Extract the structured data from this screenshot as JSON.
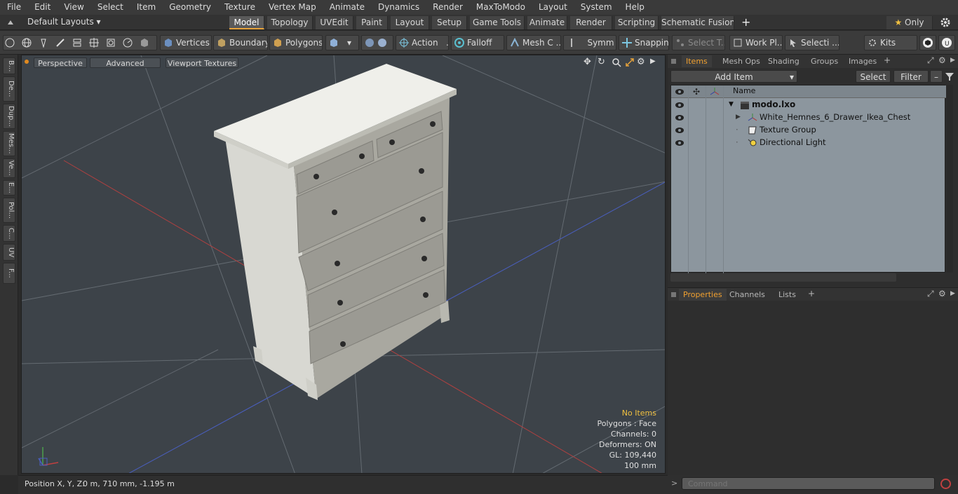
{
  "menu": [
    "File",
    "Edit",
    "View",
    "Select",
    "Item",
    "Geometry",
    "Texture",
    "Vertex Map",
    "Animate",
    "Dynamics",
    "Render",
    "MaxToModo",
    "Layout",
    "System",
    "Help"
  ],
  "layout_selector": "Default Layouts",
  "layout_tabs": [
    "Model",
    "Topology",
    "UVEdit",
    "Paint",
    "Layout",
    "Setup",
    "Game Tools",
    "Animate",
    "Render",
    "Scripting",
    "Schematic Fusion"
  ],
  "active_layout_tab": "Model",
  "only_label": "Only",
  "toolbar": {
    "vertices": "Vertices",
    "boundary": "Boundary",
    "polygons": "Polygons",
    "action": "Action",
    "action_more": "...",
    "falloff": "Falloff",
    "mesh_c": "Mesh C ...",
    "symm": "Symm ...",
    "snapping": "Snapping",
    "select_t": "Select T...",
    "work_pl": "Work Pl...",
    "selecti": "Selecti ...",
    "kits": "Kits"
  },
  "left_tabs": [
    "B...",
    "De...",
    "Dup...",
    "Mes...",
    "Ve...",
    "E...",
    "Pol...",
    "C...",
    "UV",
    "F..."
  ],
  "viewport": {
    "perspective": "Perspective",
    "advanced": "Advanced",
    "viewport_textures": "Viewport Textures",
    "hud": {
      "no_items": "No Items",
      "polygons": "Polygons : Face",
      "channels": "Channels: 0",
      "deformers": "Deformers: ON",
      "gl": "GL: 109,440",
      "scale": "100 mm"
    },
    "hud_accent": "#f0c040",
    "grid_color": "#6e757c",
    "axis_x_color": "#b04040",
    "axis_z_color": "#4a5fc0",
    "background": "#3d4349"
  },
  "status": {
    "position_label": "Position X, Y, Z:",
    "position_value": "0 m, 710 mm, -1.195 m"
  },
  "items_panel": {
    "tabs": [
      "Items",
      "Mesh Ops",
      "Shading",
      "Groups",
      "Images"
    ],
    "active_tab": "Items",
    "add_item": "Add Item",
    "select": "Select",
    "filter": "Filter",
    "name_header": "Name",
    "rows": [
      {
        "label": "modo.lxo",
        "indent": 0
      },
      {
        "label": "White_Hemnes_6_Drawer_Ikea_Chest",
        "indent": 1
      },
      {
        "label": "Texture Group",
        "indent": 1
      },
      {
        "label": "Directional Light",
        "indent": 1
      }
    ]
  },
  "properties_panel": {
    "tabs": [
      "Properties",
      "Channels",
      "Lists"
    ],
    "active_tab": "Properties"
  },
  "command": {
    "placeholder": "Command"
  },
  "accent_color": "#e8a33a"
}
